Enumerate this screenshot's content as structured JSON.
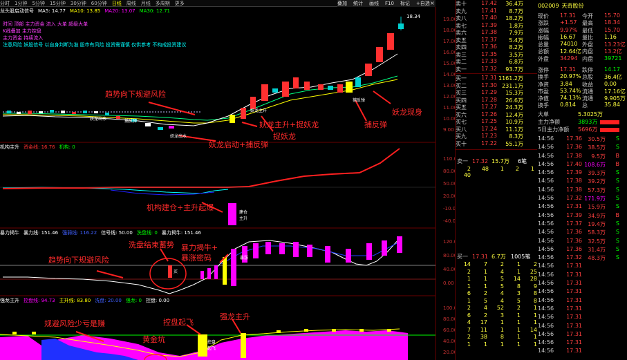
{
  "topbar": {
    "periods": [
      "分时",
      "1分钟",
      "5分钟",
      "15分钟",
      "30分钟",
      "60分钟",
      "日线",
      "周线",
      "月线",
      "多周期",
      "更多"
    ],
    "active_period": "日线",
    "tools": [
      "叠加",
      "统计",
      "画线",
      "F10",
      "标记",
      "+自选",
      "返回"
    ]
  },
  "main_panel": {
    "title": "龙头股启动信号",
    "items": [
      "MA5: 14.77",
      "MA10: 13.85",
      "MA20: 13.07",
      "MA30: 12.71"
    ],
    "price_labels": [
      "19.00",
      "18.00",
      "17.00",
      "16.00",
      "15.00",
      "14.00",
      "13.00",
      "12.00",
      "11.00",
      "10.00",
      "9.00"
    ],
    "high_label": "18.34",
    "notes": [
      "时间 顶部 主力资金 流入 大单 超级大单",
      "K线叠加 主力控盘",
      "主力资金 持续流入"
    ],
    "scroll_text": "注意风险 妖股信号 以自身判断为准 股市有风险 投资需谨慎 仅供参考 不构成投资建议",
    "annotations": {
      "trend": "趋势向下规避风险",
      "main_rise": "妖龙主升+捉妖龙",
      "catch": "捉妖龙",
      "rebound": "捕反弹",
      "appear": "妖龙现身",
      "start": "妖龙启动+捕反弹"
    },
    "tags": [
      "妖龙出水",
      "捕反弹",
      "妖龙主升",
      "捕反弹",
      "妖龙出水"
    ]
  },
  "panel2": {
    "title": "机构主升",
    "items": [
      "资金线: 16.76",
      "机构: 0"
    ],
    "price_labels": [
      "110.00",
      "80.00",
      "50.00",
      "20.00",
      "-10.00",
      "-40.00"
    ],
    "annotation": "机构建仓+主升起爆",
    "tags": [
      "建仓",
      "主升"
    ]
  },
  "panel3": {
    "title": "暴力揭牛",
    "items": [
      "暴力线: 151.46",
      "强弱线: 116.22",
      "信号线: 50.00",
      "洗盘线: 0",
      "暴力揭牛: 151.46"
    ],
    "price_labels": [
      "120.00",
      "80.00",
      "40.00",
      "0.00"
    ],
    "annotations": {
      "wash": "洗盘结束蓄势",
      "bull": "暴力揭牛+",
      "secret": "暴涨密码",
      "trend": "趋势向下规避风险"
    },
    "tags": [
      "买",
      "暴涨"
    ]
  },
  "panel4": {
    "title": "强龙主升",
    "items": [
      "控盘线: 94.73",
      "主升线: 83.80",
      "洗盘: 20.00",
      "强龙: 0",
      "控盘: 0.00"
    ],
    "price_labels": [
      "100.00",
      "80.00",
      "60.00",
      "40.00",
      "20.00"
    ],
    "annotations": {
      "risk": "规避风险少亏是赚",
      "gold": "黄金坑",
      "fly": "控盘起飞",
      "strong": "强龙主升"
    },
    "tags": [
      "控盘",
      "起飞"
    ]
  },
  "right_panel": {
    "stock_code": "002009",
    "stock_name": "天奇股份",
    "asks": [
      {
        "label": "卖十",
        "price": "17.42",
        "vol": "36.4万"
      },
      {
        "label": "卖九",
        "price": "17.41",
        "vol": "8.7万"
      },
      {
        "label": "卖八",
        "price": "17.40",
        "vol": "18.2万"
      },
      {
        "label": "卖七",
        "price": "17.39",
        "vol": "1.8万"
      },
      {
        "label": "卖六",
        "price": "17.38",
        "vol": "7.9万"
      },
      {
        "label": "卖五",
        "price": "17.37",
        "vol": "5.4万"
      },
      {
        "label": "卖四",
        "price": "17.36",
        "vol": "8.2万"
      },
      {
        "label": "卖三",
        "price": "17.35",
        "vol": "3.5万"
      },
      {
        "label": "卖二",
        "price": "17.33",
        "vol": "6.8万"
      },
      {
        "label": "卖一",
        "price": "17.32",
        "vol": "93.7万"
      }
    ],
    "bids": [
      {
        "label": "买一",
        "price": "17.31",
        "vol": "1161.2万"
      },
      {
        "label": "买二",
        "price": "17.30",
        "vol": "231.1万"
      },
      {
        "label": "买三",
        "price": "17.29",
        "vol": "15.3万"
      },
      {
        "label": "买四",
        "price": "17.28",
        "vol": "26.6万"
      },
      {
        "label": "买五",
        "price": "17.27",
        "vol": "24.3万"
      },
      {
        "label": "买六",
        "price": "17.26",
        "vol": "12.4万"
      },
      {
        "label": "买七",
        "price": "17.25",
        "vol": "10.9万"
      },
      {
        "label": "买八",
        "price": "17.24",
        "vol": "11.1万"
      },
      {
        "label": "买九",
        "price": "17.23",
        "vol": "8.3万"
      },
      {
        "label": "买十",
        "price": "17.22",
        "vol": "55.1万"
      }
    ],
    "quote": [
      [
        "现价",
        "17.31",
        "今开",
        "15.70"
      ],
      [
        "涨跌",
        "+1.57",
        "最高",
        "18.34"
      ],
      [
        "涨幅",
        "9.97%",
        "最低",
        "15.70"
      ],
      [
        "振幅",
        "16.67",
        "量比",
        "1.16"
      ],
      [
        "总量",
        "74010",
        "外盘",
        "13.23亿"
      ],
      [
        "总额",
        "12.64亿",
        "内盘",
        "13.2亿"
      ],
      [
        "外盘",
        "34294",
        "内盘",
        "39721"
      ]
    ],
    "stats": [
      [
        "涨停",
        "17.31",
        "跌停",
        "14.17"
      ],
      [
        "换手",
        "20.97%",
        "总股",
        "36.4亿"
      ],
      [
        "净资",
        "3.84",
        "收益",
        "0.00"
      ],
      [
        "市盈",
        "53.74%",
        "流通",
        "17.16亿"
      ],
      [
        "净值",
        "74.13%",
        "流通",
        "9.905万"
      ],
      [
        "换手",
        "0.814",
        "总",
        "35.84"
      ]
    ],
    "flow": [
      {
        "label": "大单",
        "value": "5.3025万"
      },
      {
        "label": "主力净额",
        "value": "3893万"
      },
      {
        "label": "5日主力净额",
        "value": "5696万"
      }
    ],
    "mid_quote": {
      "sell": "卖一",
      "price": "17.32",
      "vol": "15.7万",
      "count": "6笔"
    },
    "mid_rows": [
      [
        "2",
        "48",
        "1",
        "2",
        "1"
      ],
      [
        "40",
        "",
        "",
        "",
        ""
      ]
    ],
    "bot_quote": {
      "buy": "买一",
      "price": "17.31",
      "vol": "6.7万",
      "count": "1005笔"
    },
    "bot_rows": [
      [
        "14",
        "7",
        "2",
        "1",
        "2"
      ],
      [
        "2",
        "1",
        "4",
        "1",
        "25"
      ],
      [
        "1",
        "1",
        "5",
        "14",
        "28"
      ],
      [
        "1",
        "1",
        "5",
        "8",
        "9"
      ],
      [
        "6",
        "2",
        "4",
        "3",
        "8"
      ],
      [
        "1",
        "5",
        "4",
        "5",
        "8"
      ],
      [
        "2",
        "4",
        "52",
        "2",
        "1"
      ],
      [
        "6",
        "2",
        "3",
        "1",
        "1"
      ],
      [
        "4",
        "17",
        "1",
        "1",
        "1"
      ],
      [
        "7",
        "11",
        "1",
        "1",
        "14"
      ],
      [
        "2",
        "38",
        "8",
        "1",
        "1"
      ],
      [
        "1",
        "1",
        "1",
        "1",
        "1"
      ]
    ],
    "ticks": [
      {
        "t": "14:56",
        "p": "17.36",
        "v": "30.5万",
        "s": "S"
      },
      {
        "t": "14:56",
        "p": "17.36",
        "v": "38.5万",
        "s": "S"
      },
      {
        "t": "14:56",
        "p": "17.38",
        "v": "9.5万",
        "s": "B"
      },
      {
        "t": "14:56",
        "p": "17.40",
        "v": "108.6万",
        "s": "B"
      },
      {
        "t": "14:56",
        "p": "17.39",
        "v": "39.3万",
        "s": "S"
      },
      {
        "t": "14:56",
        "p": "17.38",
        "v": "39.2万",
        "s": "S"
      },
      {
        "t": "14:56",
        "p": "17.38",
        "v": "57.3万",
        "s": "S"
      },
      {
        "t": "14:56",
        "p": "17.32",
        "v": "171.9万",
        "s": "S"
      },
      {
        "t": "14:56",
        "p": "17.31",
        "v": "15.9万",
        "s": "S"
      },
      {
        "t": "14:56",
        "p": "17.39",
        "v": "34.9万",
        "s": "B"
      },
      {
        "t": "14:56",
        "p": "17.37",
        "v": "19.4万",
        "s": "S"
      },
      {
        "t": "14:56",
        "p": "17.36",
        "v": "58.3万",
        "s": "S"
      },
      {
        "t": "14:56",
        "p": "17.36",
        "v": "32.5万",
        "s": "S"
      },
      {
        "t": "14:56",
        "p": "17.36",
        "v": "31.4万",
        "s": "S"
      },
      {
        "t": "14:56",
        "p": "17.32",
        "v": "48.3万",
        "s": "S"
      },
      {
        "t": "14:56",
        "p": "17.31",
        "v": "",
        "s": ""
      },
      {
        "t": "14:56",
        "p": "17.31",
        "v": "",
        "s": ""
      },
      {
        "t": "14:56",
        "p": "17.31",
        "v": "",
        "s": ""
      },
      {
        "t": "14:56",
        "p": "17.31",
        "v": "",
        "s": ""
      },
      {
        "t": "14:56",
        "p": "17.31",
        "v": "",
        "s": ""
      },
      {
        "t": "14:56",
        "p": "17.31",
        "v": "",
        "s": ""
      },
      {
        "t": "14:56",
        "p": "17.31",
        "v": "",
        "s": ""
      },
      {
        "t": "14:56",
        "p": "17.31",
        "v": "",
        "s": ""
      },
      {
        "t": "14:56",
        "p": "17.31",
        "v": "",
        "s": ""
      },
      {
        "t": "14:56",
        "p": "17.31",
        "v": "",
        "s": ""
      },
      {
        "t": "14:56",
        "p": "17.31",
        "v": "",
        "s": ""
      },
      {
        "t": "14:56",
        "p": "17.31",
        "v": "",
        "s": ""
      }
    ],
    "colors": {
      "up": "#ff3030",
      "down": "#00d0d0",
      "yellow": "#ffff00",
      "magenta": "#ff00ff",
      "white": "#ffffff"
    }
  }
}
